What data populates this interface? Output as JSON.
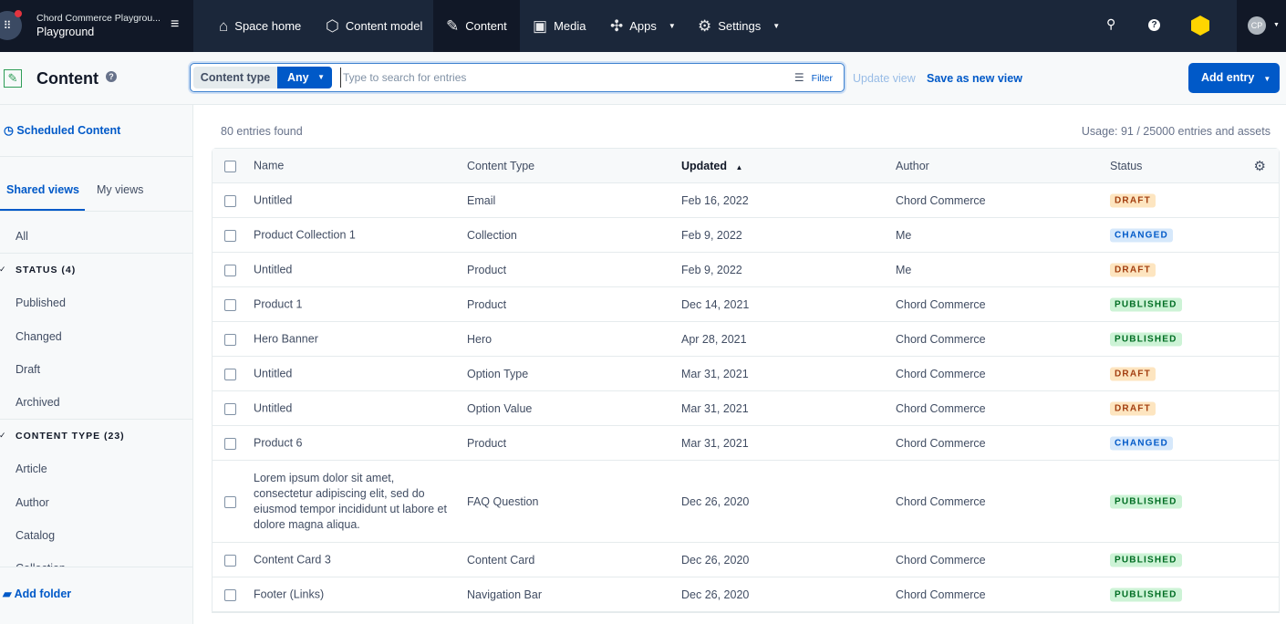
{
  "topbar": {
    "org_name": "Chord Commerce Playgrou...",
    "space_name": "Playground",
    "nav": [
      {
        "label": "Space home",
        "icon": "home-icon"
      },
      {
        "label": "Content model",
        "icon": "box-icon"
      },
      {
        "label": "Content",
        "icon": "edit-icon"
      },
      {
        "label": "Media",
        "icon": "image-icon"
      },
      {
        "label": "Apps",
        "icon": "puzzle-icon"
      },
      {
        "label": "Settings",
        "icon": "gear-icon"
      }
    ],
    "avatar": "CP"
  },
  "header": {
    "title": "Content",
    "content_type_label": "Content type",
    "content_type_value": "Any",
    "search_placeholder": "Type to search for entries",
    "filter_label": "Filter",
    "update_view": "Update view",
    "save_view": "Save as new view",
    "add_entry": "Add entry"
  },
  "sidebar": {
    "scheduled": "Scheduled Content",
    "tabs": [
      "Shared views",
      "My views"
    ],
    "all": "All",
    "status_heading": "STATUS (4)",
    "status_items": [
      "Published",
      "Changed",
      "Draft",
      "Archived"
    ],
    "ct_heading": "CONTENT TYPE (23)",
    "ct_items": [
      "Article",
      "Author",
      "Catalog",
      "Collection"
    ],
    "add_folder": "Add folder"
  },
  "main": {
    "found": "80 entries found",
    "usage": "Usage: 91 / 25000 entries and assets",
    "columns": [
      "Name",
      "Content Type",
      "Updated",
      "Author",
      "Status"
    ],
    "rows": [
      {
        "name": "Untitled",
        "type": "Email",
        "updated": "Feb 16, 2022",
        "author": "Chord Commerce",
        "status": "DRAFT"
      },
      {
        "name": "Product Collection 1",
        "type": "Collection",
        "updated": "Feb 9, 2022",
        "author": "Me",
        "status": "CHANGED"
      },
      {
        "name": "Untitled",
        "type": "Product",
        "updated": "Feb 9, 2022",
        "author": "Me",
        "status": "DRAFT"
      },
      {
        "name": "Product 1",
        "type": "Product",
        "updated": "Dec 14, 2021",
        "author": "Chord Commerce",
        "status": "PUBLISHED"
      },
      {
        "name": "Hero Banner",
        "type": "Hero",
        "updated": "Apr 28, 2021",
        "author": "Chord Commerce",
        "status": "PUBLISHED"
      },
      {
        "name": "Untitled",
        "type": "Option Type",
        "updated": "Mar 31, 2021",
        "author": "Chord Commerce",
        "status": "DRAFT"
      },
      {
        "name": "Untitled",
        "type": "Option Value",
        "updated": "Mar 31, 2021",
        "author": "Chord Commerce",
        "status": "DRAFT"
      },
      {
        "name": "Product 6",
        "type": "Product",
        "updated": "Mar 31, 2021",
        "author": "Chord Commerce",
        "status": "CHANGED"
      },
      {
        "name": "Lorem ipsum dolor sit amet, consectetur adipiscing elit, sed do eiusmod tempor incididunt ut labore et dolore magna aliqua.",
        "type": "FAQ Question",
        "updated": "Dec 26, 2020",
        "author": "Chord Commerce",
        "status": "PUBLISHED"
      },
      {
        "name": "Content Card 3",
        "type": "Content Card",
        "updated": "Dec 26, 2020",
        "author": "Chord Commerce",
        "status": "PUBLISHED"
      },
      {
        "name": "Footer (Links)",
        "type": "Navigation Bar",
        "updated": "Dec 26, 2020",
        "author": "Chord Commerce",
        "status": "PUBLISHED"
      }
    ]
  },
  "status_colors": {
    "DRAFT": {
      "bg": "#fde5c0",
      "fg": "#a33e10"
    },
    "CHANGED": {
      "bg": "#d6e8fb",
      "fg": "#0059c8"
    },
    "PUBLISHED": {
      "bg": "#cdf3d6",
      "fg": "#006d23"
    }
  }
}
